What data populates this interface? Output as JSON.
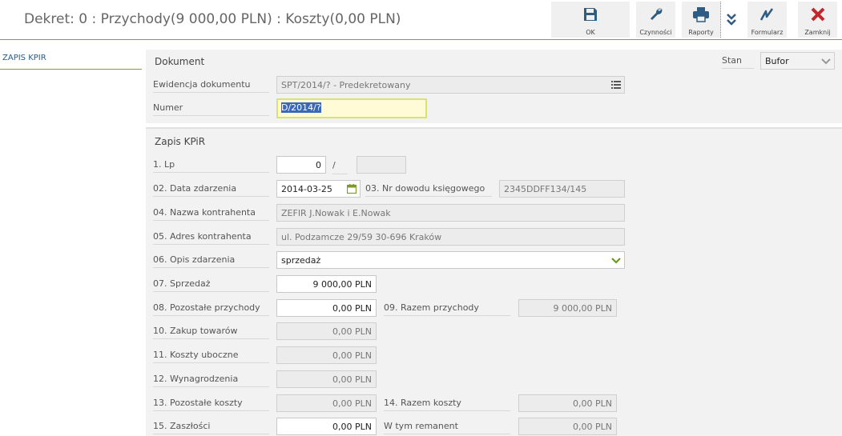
{
  "header": {
    "title": "Dekret: 0 : Przychody(9 000,00 PLN) : Koszty(0,00 PLN)"
  },
  "toolbar": [
    {
      "id": "ok",
      "label": "OK",
      "icon": "save-icon"
    },
    {
      "id": "czynnosci",
      "label": "Czynności",
      "icon": "wrench-icon"
    },
    {
      "id": "raporty",
      "label": "Raporty",
      "icon": "printer-icon"
    },
    {
      "id": "formularz",
      "label": "Formularz",
      "icon": "signature-icon"
    },
    {
      "id": "zamknij",
      "label": "Zamknij",
      "icon": "close-icon"
    }
  ],
  "nav": {
    "items": [
      "ZAPIS KPIR"
    ]
  },
  "dokument": {
    "title": "Dokument",
    "stan_label": "Stan",
    "stan_value": "Bufor",
    "ewidencja_label": "Ewidencja dokumentu",
    "ewidencja_value": "SPT/2014/? - Predekretowany",
    "numer_label": "Numer",
    "numer_value": "D/2014/?"
  },
  "kpir": {
    "title": "Zapis KPiR",
    "lp_label": "1. Lp",
    "lp_value": "0",
    "lp_slash": "/",
    "lp_second": "",
    "data_label": "02. Data zdarzenia",
    "data_value": "2014-03-25",
    "nr_dowodu_label": "03. Nr dowodu księgowego",
    "nr_dowodu_value": "2345DDFF134/145",
    "kontrahent_label": "04. Nazwa kontrahenta",
    "kontrahent_value": "ZEFIR J.Nowak i E.Nowak",
    "adres_label": "05. Adres kontrahenta",
    "adres_value": "ul. Podzamcze 29/59 30-696 Kraków",
    "opis_label": "06. Opis zdarzenia",
    "opis_value": "sprzedaż",
    "sprzedaz_label": "07. Sprzedaż",
    "sprzedaz_value": "9 000,00 PLN",
    "pozostale_przychody_label": "08. Pozostałe przychody",
    "pozostale_przychody_value": "0,00 PLN",
    "razem_przychody_label": "09. Razem przychody",
    "razem_przychody_value": "9 000,00 PLN",
    "zakup_label": "10. Zakup towarów",
    "zakup_value": "0,00 PLN",
    "koszty_uboczne_label": "11. Koszty uboczne",
    "koszty_uboczne_value": "0,00 PLN",
    "wynagrodzenia_label": "12. Wynagrodzenia",
    "wynagrodzenia_value": "0,00 PLN",
    "pozostale_koszty_label": "13. Pozostałe koszty",
    "pozostale_koszty_value": "0,00 PLN",
    "razem_koszty_label": "14. Razem koszty",
    "razem_koszty_value": "0,00 PLN",
    "zaszlosci_label": "15. Zaszłości",
    "zaszlosci_value": "0,00 PLN",
    "remanent_label": "W tym remanent",
    "remanent_value": "0,00 PLN"
  },
  "colors": {
    "accent": "#8a9a3a",
    "close": "#c0262d",
    "icon": "#2f5c83",
    "selection": "#3a68b8"
  }
}
